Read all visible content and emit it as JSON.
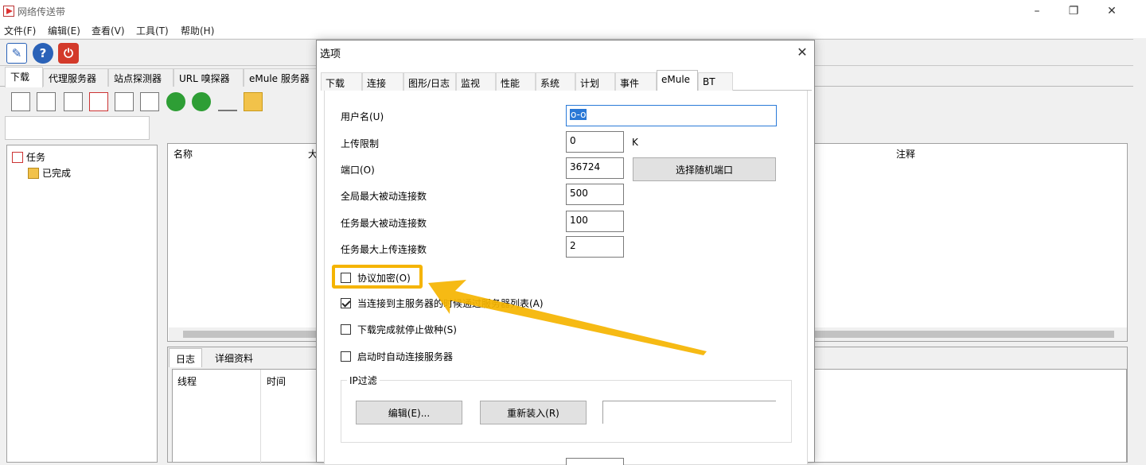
{
  "window": {
    "title": "网络传送带",
    "min_label": "–",
    "max_label": "❐",
    "close_label": "✕"
  },
  "menu": [
    "文件(F)",
    "编辑(E)",
    "查看(V)",
    "工具(T)",
    "帮助(H)"
  ],
  "toolbar1": [
    {
      "icon": "edit-options-icon",
      "glyph": "✎",
      "color": "#2a62b8"
    },
    {
      "icon": "help-icon",
      "glyph": "?",
      "color": "#2a62b8"
    },
    {
      "icon": "power-icon",
      "glyph": "⏻",
      "color": "#d33a2a"
    }
  ],
  "main_tabs": [
    "下载",
    "代理服务器",
    "站点探测器",
    "URL 嗅探器",
    "eMule 服务器"
  ],
  "toolbar2_icons": [
    "start-icon",
    "pause-icon",
    "stop-icon",
    "new-task-icon",
    "delete-icon",
    "complete-icon",
    "move-up-icon",
    "move-down-icon",
    "open-icon",
    "folder-icon"
  ],
  "tree": {
    "root": "任务",
    "child": "已完成"
  },
  "list_columns": [
    "名称",
    "大",
    "注释"
  ],
  "bottom_tabs": [
    "日志",
    "详细资料"
  ],
  "log_columns": [
    "线程",
    "时间"
  ],
  "dialog": {
    "title": "选项",
    "close_label": "✕",
    "tabs": [
      "下载",
      "连接",
      "图形/日志",
      "监视",
      "性能",
      "系统",
      "计划",
      "事件",
      "eMule",
      "BT"
    ],
    "active_tab": "eMule",
    "fields": {
      "username_label": "用户名(U)",
      "username_value": "o-o",
      "upload_limit_label": "上传限制",
      "upload_limit_value": "0",
      "upload_unit": "K",
      "port_label": "端口(O)",
      "port_value": "36724",
      "random_port_button": "选择随机端口",
      "global_max_conn_label": "全局最大被动连接数",
      "global_max_conn_value": "500",
      "task_max_conn_label": "任务最大被动连接数",
      "task_max_conn_value": "100",
      "task_max_upload_label": "任务最大上传连接数",
      "task_max_upload_value": "2"
    },
    "checkboxes": [
      {
        "label": "协议加密(O)",
        "checked": false
      },
      {
        "label": "当连接到主服务器的时候通过服务器列表(A)",
        "checked": true
      },
      {
        "label": "下载完成就停止做种(S)",
        "checked": false
      },
      {
        "label": "启动时自动连接服务器",
        "checked": false
      }
    ],
    "ip_filter": {
      "group_label": "IP过滤",
      "edit_button": "编辑(E)...",
      "reload_button": "重新装入(R)",
      "path_value": ""
    }
  },
  "annotation": {
    "highlight_color": "#f5b400"
  }
}
